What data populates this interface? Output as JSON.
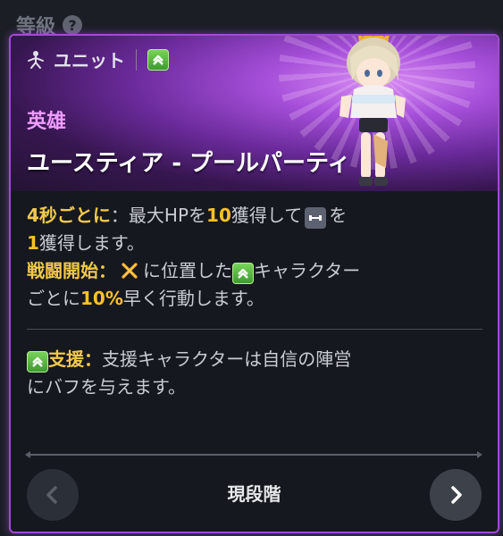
{
  "header_bar": {
    "label": "等級",
    "help_glyph": "?"
  },
  "card": {
    "type_label": "ユニット",
    "rarity": "英雄",
    "name": "ユースティア - プールパーティ",
    "accent_color": "#a24ad6"
  },
  "skills": {
    "s1_label": "4秒ごとに",
    "s1_colon": "：",
    "s1_text_a": "最大HPを",
    "s1_num_a": "10",
    "s1_text_b": "獲得して",
    "s1_text_c": "を",
    "s1_num_b": "1",
    "s1_text_d": "獲得します。",
    "s2_label": "戦闘開始：",
    "s2_text_a": "に位置した",
    "s2_text_b": "キャラクター",
    "s2_text_c": "ごとに",
    "s2_num": "10%",
    "s2_text_d": "早く行動します。",
    "s3_label": "支援",
    "s3_colon": "：",
    "s3_text_a": "支援キャラクターは自信の陣営",
    "s3_text_b": "にバフを与えます。"
  },
  "footer": {
    "stage_label": "現段階"
  },
  "icons": {
    "type_icon": "unit-type-icon",
    "faction_icon": "green-chevron-badge-icon",
    "stat_icon": "dumbbell-icon",
    "position_icon": "crossed-swords-icon",
    "prev": "chevron-left-icon",
    "next": "chevron-right-icon",
    "help": "question-circle-icon"
  }
}
